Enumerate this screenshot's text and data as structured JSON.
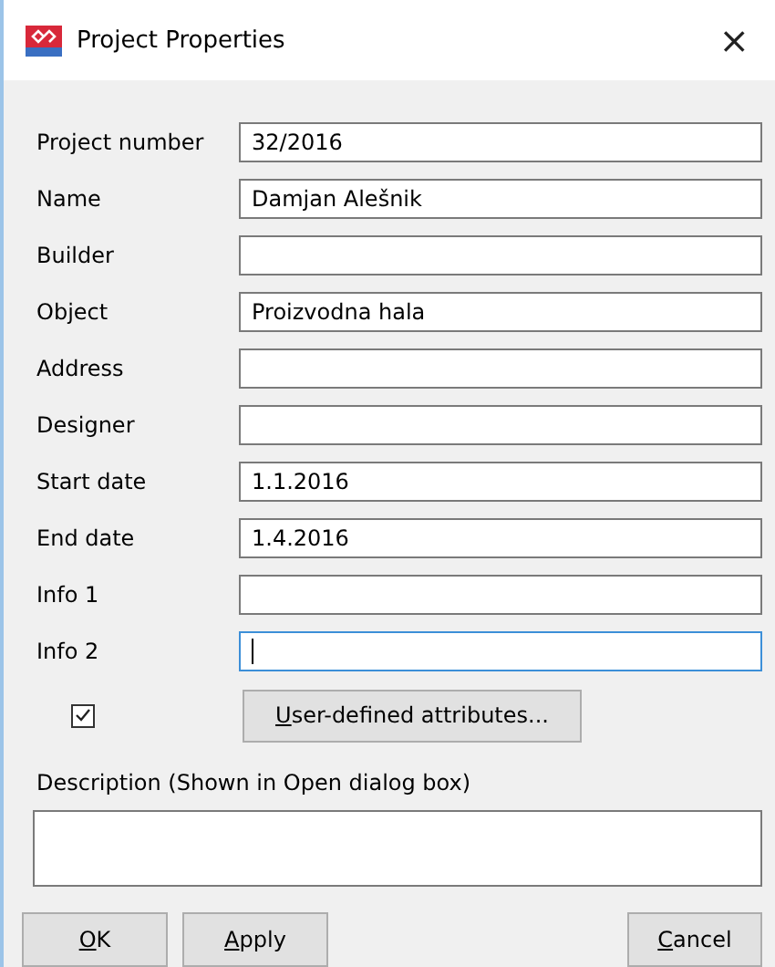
{
  "window": {
    "title": "Project Properties",
    "close": "×"
  },
  "fields": [
    {
      "label": "Project number",
      "value": "32/2016",
      "focused": false
    },
    {
      "label": "Name",
      "value": "Damjan Alešnik",
      "focused": false
    },
    {
      "label": "Builder",
      "focused": false
    },
    {
      "label": "Object",
      "value": "Proizvodna hala",
      "focused": false
    },
    {
      "label": "Address",
      "focused": false
    },
    {
      "label": "Designer",
      "focused": false
    },
    {
      "label": "Start date",
      "value": "1.1.2016",
      "focused": false
    },
    {
      "label": "End date",
      "value": "1.4.2016",
      "focused": false
    },
    {
      "label": "Info 1",
      "focused": false
    },
    {
      "label": "Info 2",
      "focused": true
    }
  ],
  "attributes": {
    "checked": true,
    "button": "User-defined attributes..."
  },
  "description": {
    "label": "Description (Shown in Open dialog box)"
  },
  "buttons": {
    "left": [
      "OK",
      "Apply"
    ],
    "right": [
      "Cancel"
    ]
  }
}
